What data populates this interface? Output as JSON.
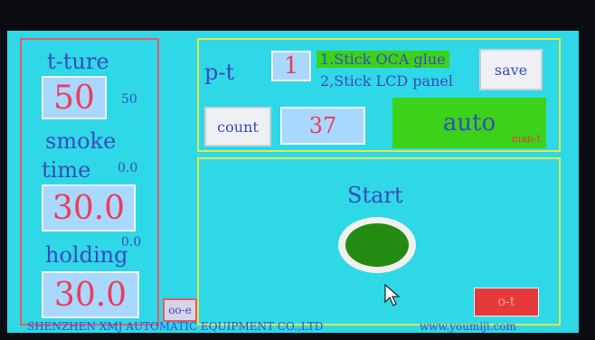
{
  "left": {
    "temperature_label": "t-ture",
    "temperature_value": "50",
    "temperature_hint": "50",
    "smoke_label": "smoke",
    "time_label": "time",
    "time_hint": "0.0",
    "time_value": "30.0",
    "holding_label": "holding",
    "holding_hint": "0.0",
    "holding_value": "30.0",
    "back_button": "oo-e"
  },
  "top": {
    "pt_label": "p-t",
    "pt_value": "1",
    "options": [
      "1.Stick OCA glue",
      "2,Stick LCD panel"
    ],
    "selected_option": 0,
    "save_label": "save",
    "count_label": "count",
    "count_value": "37",
    "auto_label": "auto",
    "auto_sub": "man-t"
  },
  "start": {
    "label": "Start",
    "ot_label": "o-t"
  },
  "footer": {
    "company": "SHENZHEN XMJ AUTOMATIC EQUIPMENT CO.,LTD",
    "website": "www.youmiji.com"
  },
  "colors": {
    "screen_bg": "#2fd8e6",
    "text_blue": "#3b4abf",
    "value_red": "#ee3b5a",
    "value_box": "#a9d8ff",
    "accent_green": "#3cd21a",
    "start_green": "#238a12",
    "danger_red": "#e63a3a",
    "left_border": "#e65a6a",
    "frame_yellow": "#e0e84a"
  },
  "icons": [
    "start-circle-icon",
    "mouse-pointer-icon"
  ]
}
